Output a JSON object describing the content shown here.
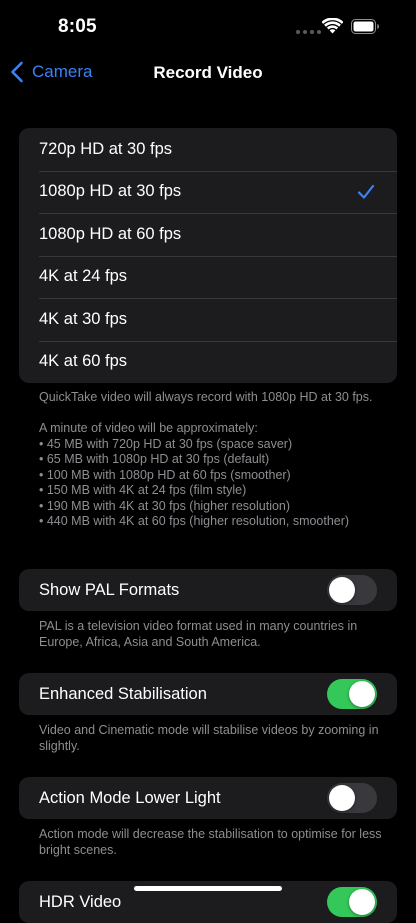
{
  "status_bar": {
    "time": "8:05"
  },
  "nav": {
    "back_label": "Camera",
    "title": "Record Video"
  },
  "resolutions": [
    {
      "label": "720p HD at 30 fps",
      "selected": false
    },
    {
      "label": "1080p HD at 30 fps",
      "selected": true
    },
    {
      "label": "1080p HD at 60 fps",
      "selected": false
    },
    {
      "label": "4K at 24 fps",
      "selected": false
    },
    {
      "label": "4K at 30 fps",
      "selected": false
    },
    {
      "label": "4K at 60 fps",
      "selected": false
    }
  ],
  "resolution_footer": {
    "quicktake_note": "QuickTake video will always record with 1080p HD at 30 fps.",
    "size_intro": "A minute of video will be approximately:",
    "sizes": [
      "• 45 MB with 720p HD at 30 fps (space saver)",
      "• 65 MB with 1080p HD at 30 fps (default)",
      "• 100 MB with 1080p HD at 60 fps (smoother)",
      "• 150 MB with 4K at 24 fps (film style)",
      "• 190 MB with 4K at 30 fps (higher resolution)",
      "• 440 MB with 4K at 60 fps (higher resolution, smoother)"
    ]
  },
  "toggles": [
    {
      "label": "Show PAL Formats",
      "on": false,
      "footer": "PAL is a television video format used in many countries in Europe, Africa, Asia and South America."
    },
    {
      "label": "Enhanced Stabilisation",
      "on": true,
      "footer": "Video and Cinematic mode will stabilise videos by zooming in slightly."
    },
    {
      "label": "Action Mode Lower Light",
      "on": false,
      "footer": "Action mode will decrease the stabilisation to optimise for less bright scenes."
    },
    {
      "label": "HDR Video",
      "on": true,
      "footer": ""
    }
  ],
  "colors": {
    "accent": "#3b82f6",
    "toggle_on": "#34c759",
    "toggle_off": "#39393d",
    "cell_bg": "#1c1c1e",
    "footnote": "#8e8e93"
  }
}
